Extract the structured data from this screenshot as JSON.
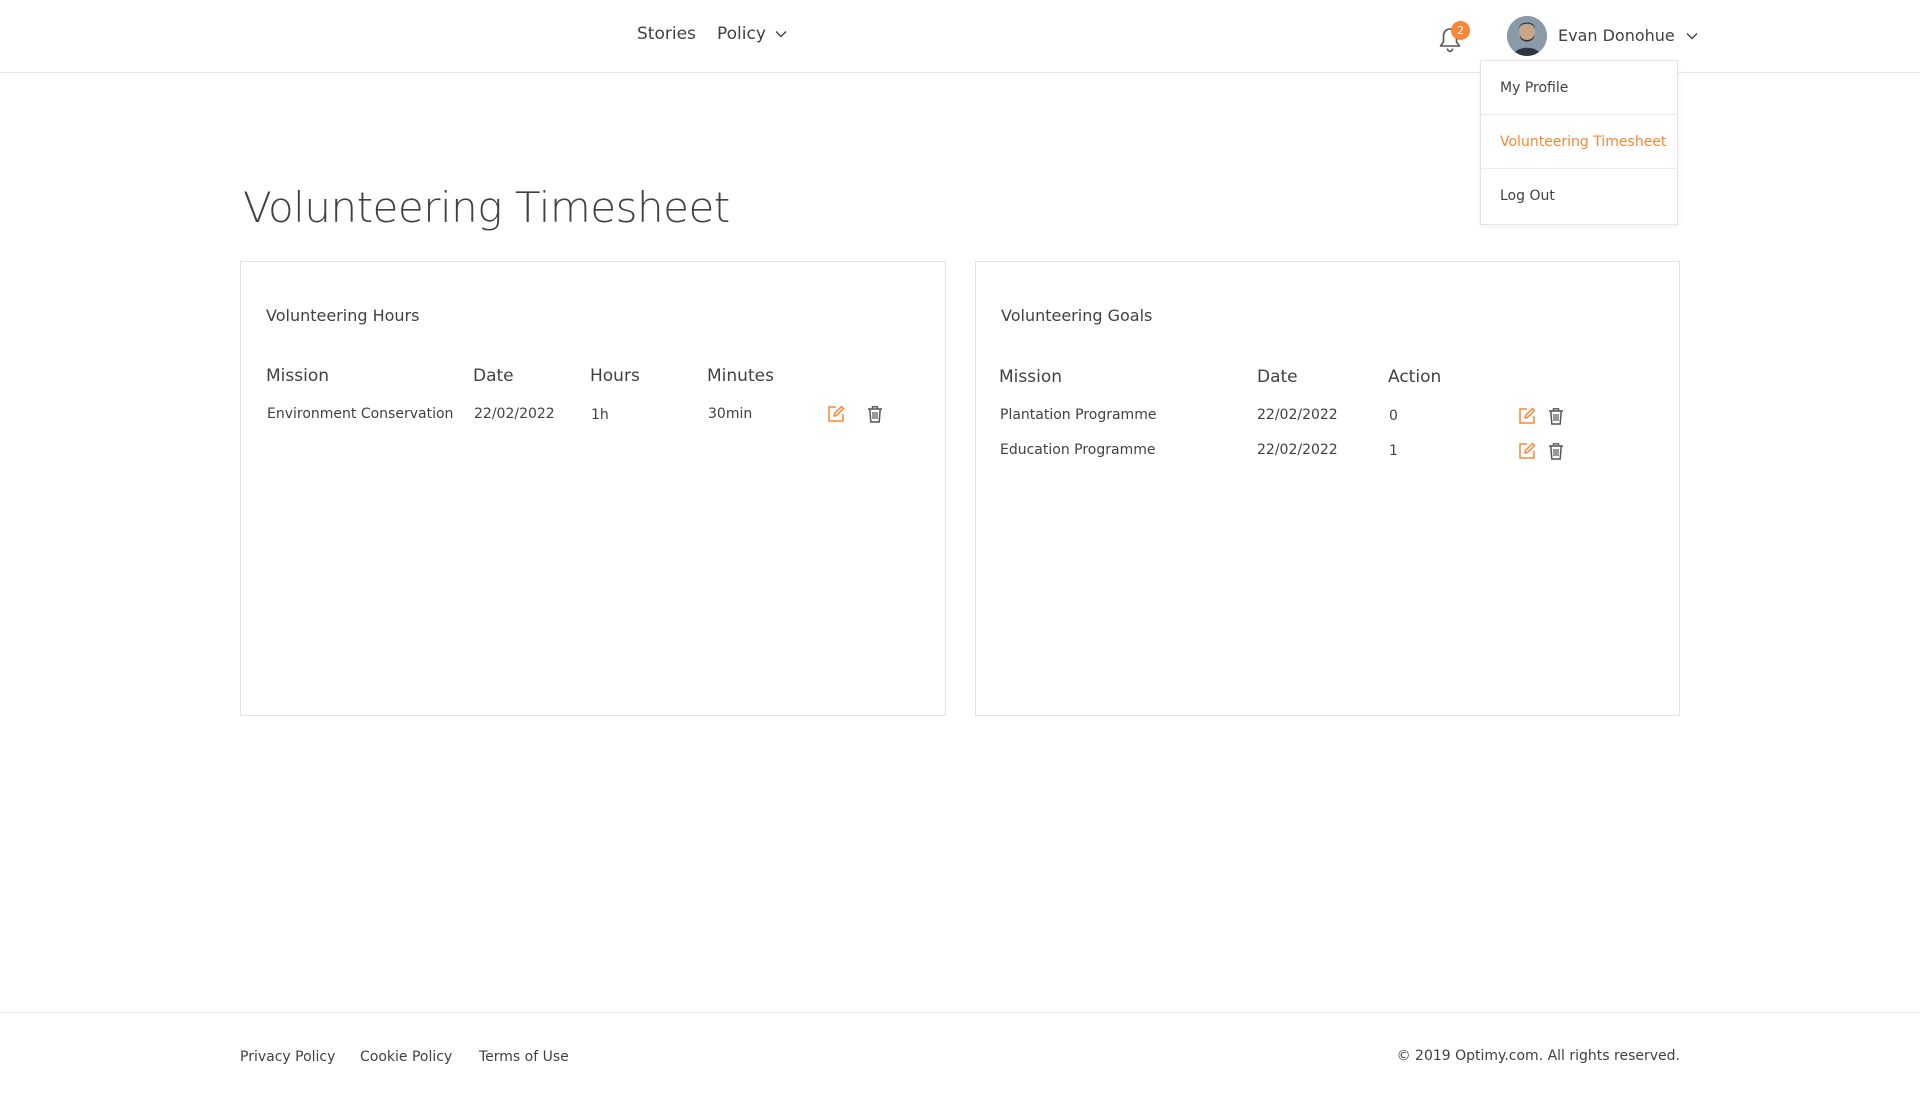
{
  "header": {
    "nav": {
      "stories": "Stories",
      "policy": "Policy"
    },
    "notifications_count": "2",
    "user_name": "Evan Donohue"
  },
  "user_menu": {
    "items": [
      {
        "label": "My Profile"
      },
      {
        "label": "Volunteering Timesheet"
      },
      {
        "label": "Log Out"
      }
    ]
  },
  "page_title": "Volunteering Timesheet",
  "hours_card": {
    "title": "Volunteering Hours",
    "columns": [
      "Mission",
      "Date",
      "Hours",
      "Minutes"
    ],
    "rows": [
      {
        "mission": "Environment Conservation",
        "date": "22/02/2022",
        "hours": "1h",
        "minutes": "30min"
      }
    ]
  },
  "goals_card": {
    "title": "Volunteering Goals",
    "columns": [
      "Mission",
      "Date",
      "Action"
    ],
    "rows": [
      {
        "mission": "Plantation Programme",
        "date": "22/02/2022",
        "action": "0"
      },
      {
        "mission": "Education Programme",
        "date": "22/02/2022",
        "action": "1"
      }
    ]
  },
  "footer": {
    "links": [
      "Privacy Policy",
      "Cookie Policy",
      "Terms of Use"
    ],
    "copyright": "© 2019 Optimy.com. All rights reserved."
  },
  "colors": {
    "accent": "#f88634",
    "text": "#414141",
    "border": "#e3e3e3"
  },
  "icons": [
    "chevron-down-icon",
    "bell-icon",
    "edit-icon",
    "trash-icon",
    "avatar"
  ]
}
